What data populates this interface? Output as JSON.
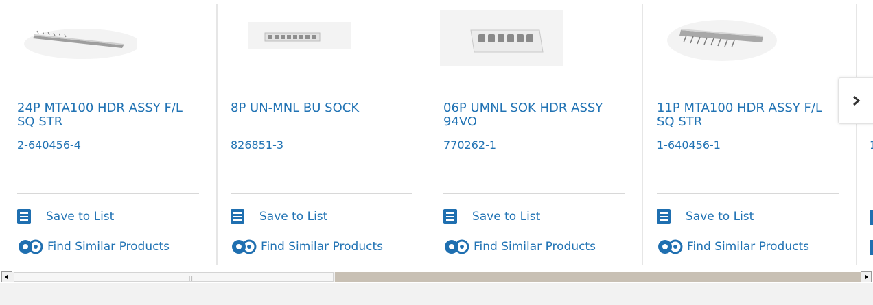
{
  "products": [
    {
      "title": "24P MTA100 HDR ASSY F/L SQ STR",
      "part_number": "2-640456-4",
      "image": "header-24-pin-image"
    },
    {
      "title": "8P UN-MNL BU SOCK",
      "part_number": "826851-3",
      "image": "socket-8-pin-image"
    },
    {
      "title": "06P UMNL SOK HDR ASSY 94VO",
      "part_number": "770262-1",
      "image": "socket-6-pin-image"
    },
    {
      "title": "11P MTA100 HDR ASSY F/L SQ STR",
      "part_number": "1-640456-1",
      "image": "header-11-pin-image"
    }
  ],
  "actions": {
    "save_label": "Save to List",
    "find_label": "Find Similar Products"
  },
  "partial_card": {
    "part_number_prefix": "1"
  },
  "colors": {
    "link": "#2173b4",
    "icon_blue": "#1f6fb0"
  },
  "scrollbar": {
    "position_fraction": 0.0
  }
}
